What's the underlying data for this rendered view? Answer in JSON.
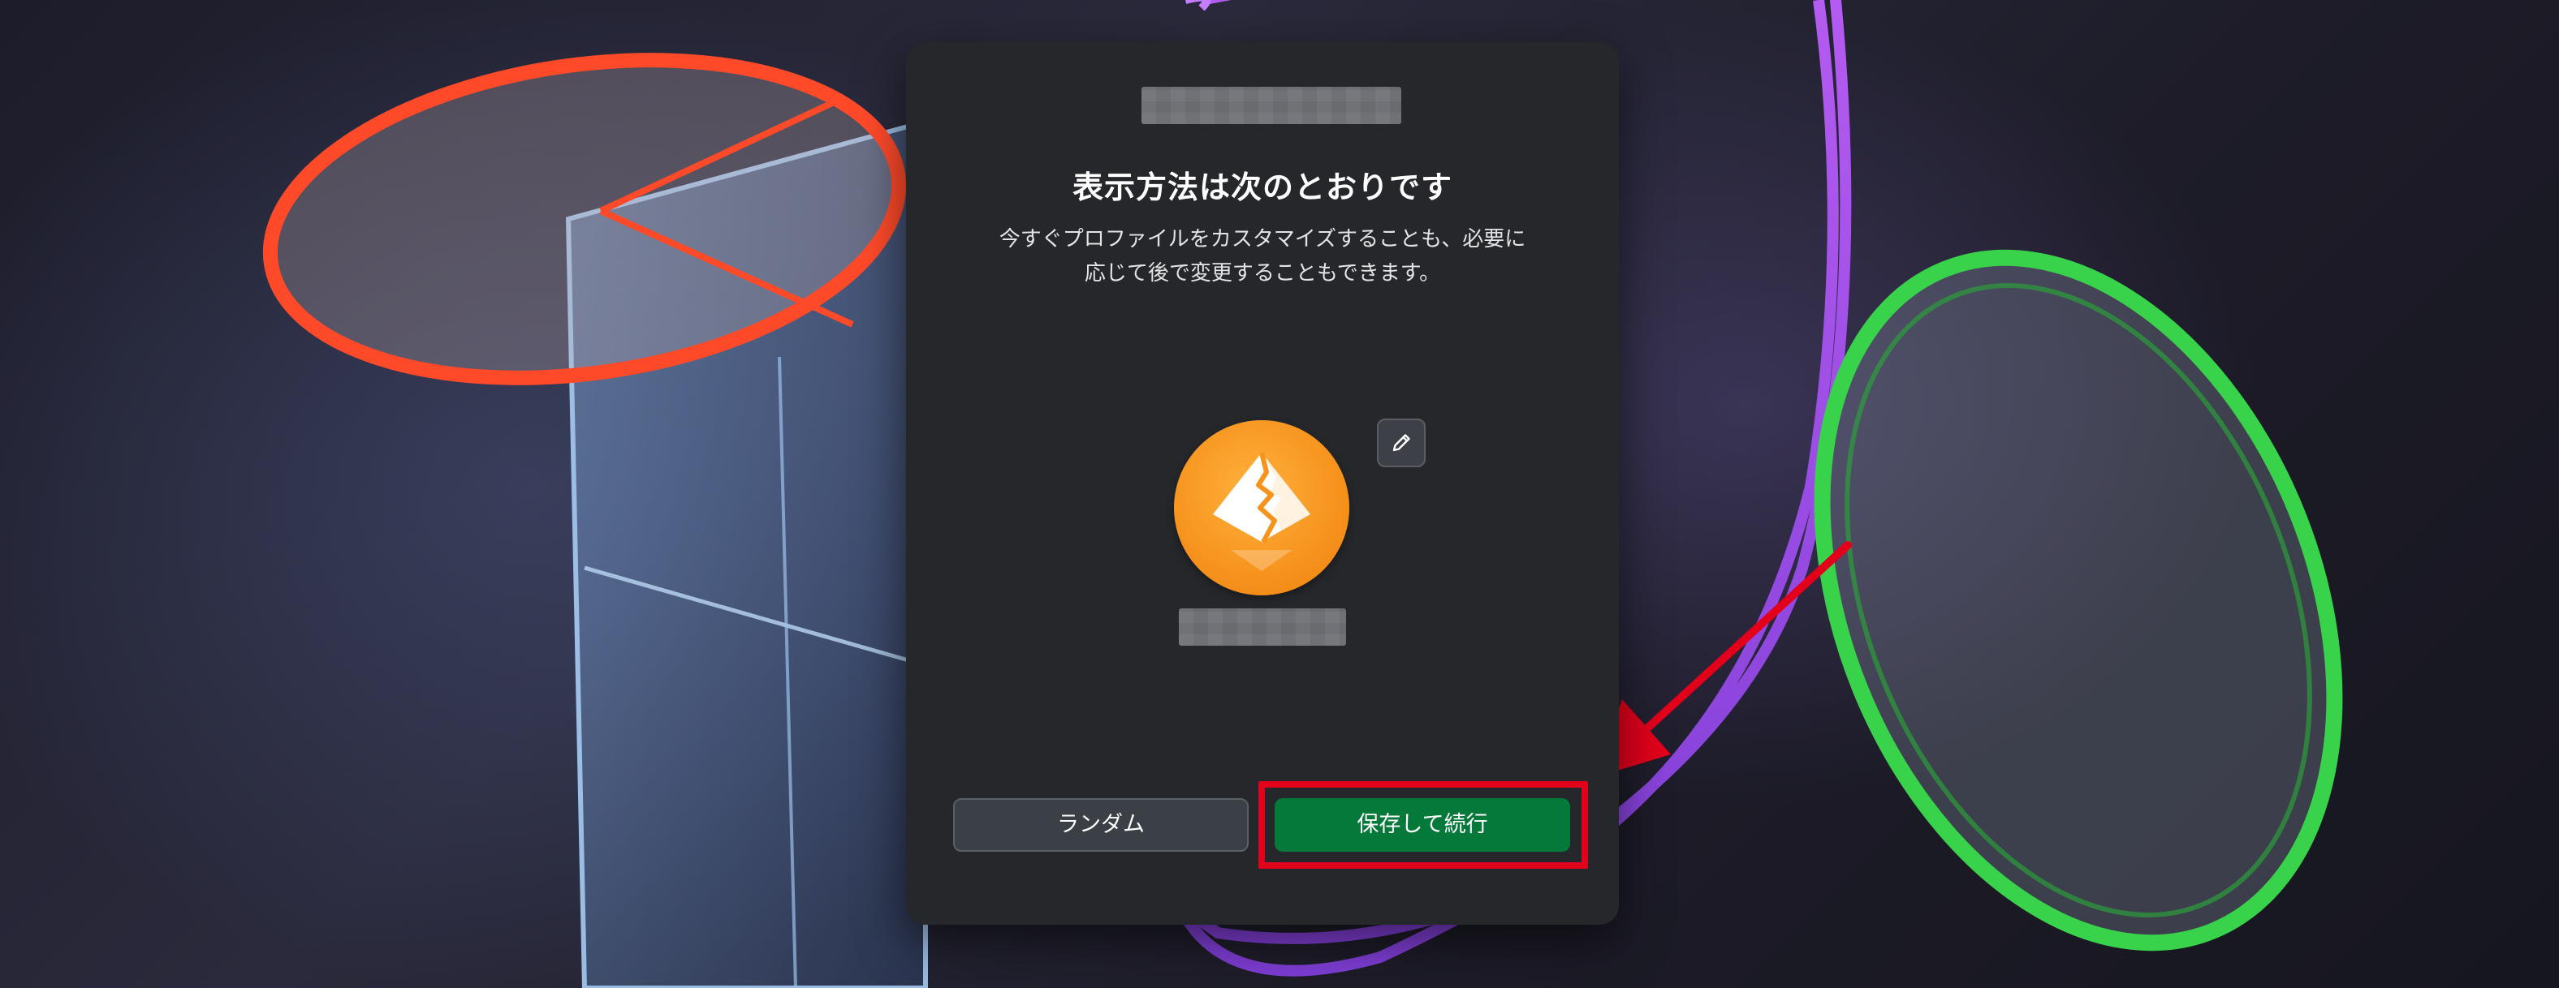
{
  "dialog": {
    "title": "表示方法は次のとおりです",
    "subtitle_line1": "今すぐプロファイルをカスタマイズすることも、必要に",
    "subtitle_line2": "応じて後で変更することもできます。",
    "avatar_icon": "mountain-logo-icon",
    "edit_icon": "pencil-icon"
  },
  "buttons": {
    "random_label": "ランダム",
    "save_label": "保存して続行"
  },
  "colors": {
    "dialog_bg": "#25272b",
    "avatar_orange": "#f6931d",
    "save_green": "#05793a",
    "annotation_red": "#e3001b"
  }
}
